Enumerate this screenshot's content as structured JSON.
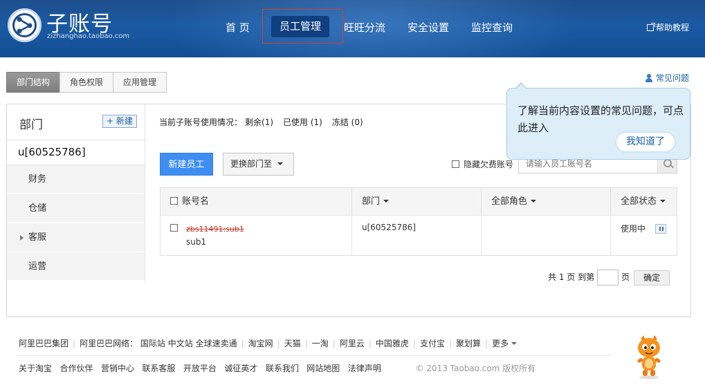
{
  "header": {
    "logo_title": "子账号",
    "logo_sub": "zizhanghao.taobao.com",
    "nav": [
      "首 页",
      "员工管理",
      "旺旺分流",
      "安全设置",
      "监控查询"
    ],
    "help": "帮助教程"
  },
  "tabs": [
    "部门结构",
    "角色权限",
    "应用管理"
  ],
  "faq": "常见问题",
  "sidebar": {
    "title": "部门",
    "new_label": "+ 新建",
    "root": "u[60525786]",
    "items": [
      "财务",
      "仓储",
      "客服",
      "运营"
    ]
  },
  "usage": {
    "label": "当前子账号使用情况：",
    "remaining": "剩余(1)",
    "used": "已使用 (1)",
    "frozen": "冻结 (0)"
  },
  "toolbar": {
    "new_employee": "新建员工",
    "move_dept": "更换部门至",
    "hide_overdue": "隐藏欠费账号",
    "search_placeholder": "请输入员工账号名"
  },
  "table": {
    "headers": [
      "账号名",
      "部门",
      "全部角色",
      "全部状态"
    ],
    "rows": [
      {
        "account_strike": "zbs11491:sub1",
        "account": "sub1",
        "dept": "u[60525786]",
        "role": "",
        "status": "使用中"
      }
    ]
  },
  "pager": {
    "prefix": "共 1 页 到第",
    "suffix": "页",
    "ok": "确定"
  },
  "tip": {
    "text": "了解当前内容设置的常见问题，可点此进入",
    "button": "我知道了"
  },
  "footer": {
    "row1": [
      "阿里巴巴集团",
      "阿里巴巴网络：",
      "国际站",
      "中文站",
      "全球速卖通",
      "淘宝网",
      "天猫",
      "一淘",
      "阿里云",
      "中国雅虎",
      "支付宝",
      "聚划算",
      "更多"
    ],
    "row2": [
      "关于淘宝",
      "合作伙伴",
      "营销中心",
      "联系客服",
      "开放平台",
      "诚征英才",
      "联系我们",
      "网站地图",
      "法律声明"
    ],
    "copyright": "© 2013 Taobao.com 版权所有"
  },
  "colors": {
    "header_blue": "#1a5aa3",
    "primary_button": "#3d8ef0",
    "tip_bg": "#ddeef9"
  }
}
